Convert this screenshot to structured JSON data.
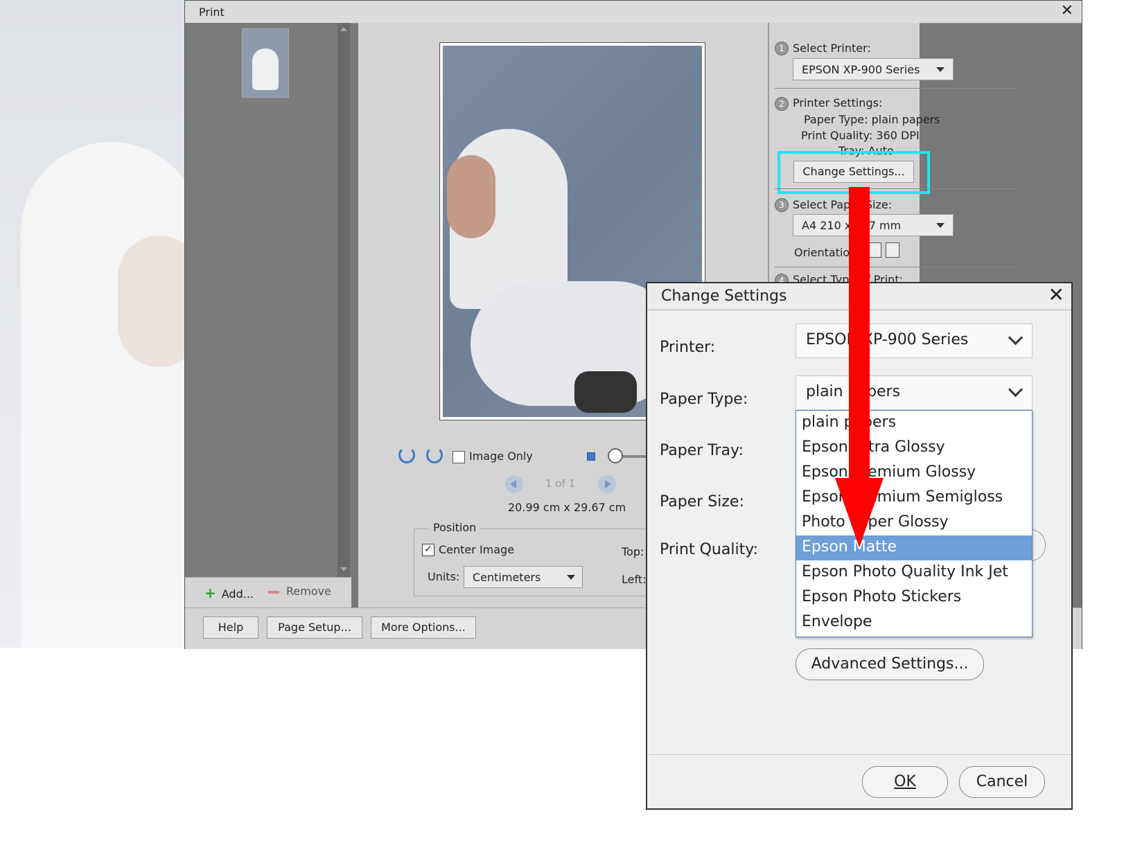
{
  "print_window": {
    "title": "Print",
    "close_glyph": "✕",
    "thumbnails": {
      "add_label": "Add...",
      "remove_label": "Remove"
    },
    "preview": {
      "image_only_label": "Image Only",
      "page_indicator": "1 of 1",
      "dimensions": "20.99 cm x 29.67 cm"
    },
    "position": {
      "legend": "Position",
      "center_image_label": "Center Image",
      "center_image_checked": true,
      "units_label": "Units:",
      "units_value": "Centimeters",
      "top_label": "Top:",
      "left_label": "Left:"
    },
    "bottom_buttons": {
      "help": "Help",
      "page_setup": "Page Setup...",
      "more_options": "More Options..."
    },
    "settings": {
      "step1_num": "1",
      "step1_label": "Select Printer:",
      "printer_value": "EPSON XP-900 Series",
      "step2_num": "2",
      "step2_label": "Printer Settings:",
      "paper_type_line": "Paper Type:  plain papers",
      "print_quality_line": "Print Quality:  360 DPI",
      "tray_line": "Tray:  Auto",
      "change_settings_label": "Change Settings...",
      "step3_num": "3",
      "step3_label": "Select Paper Size:",
      "paper_size_value": "A4 210 x 297 mm",
      "orientation_label": "Orientation:",
      "step4_num": "4",
      "step4_label": "Select Type of Print:"
    }
  },
  "change_settings_dialog": {
    "title": "Change Settings",
    "close_glyph": "✕",
    "printer_label": "Printer:",
    "printer_value": "EPSON XP-900 Series",
    "paper_type_label": "Paper Type:",
    "paper_type_value": "plain papers",
    "paper_tray_label": "Paper Tray:",
    "paper_size_label": "Paper Size:",
    "print_quality_label": "Print Quality:",
    "paper_type_options": [
      "plain papers",
      "Epson Ultra Glossy",
      "Epson Premium Glossy",
      "Epson Premium Semigloss",
      "Photo Paper Glossy",
      "Epson Matte",
      "Epson Photo Quality Ink Jet",
      "Epson Photo Stickers",
      "Envelope"
    ],
    "highlighted_option": "Epson Matte",
    "advanced_settings_label": "Advanced Settings...",
    "ok_label": "OK",
    "cancel_label": "Cancel"
  },
  "annotation": {
    "highlight_color": "#1ee6f0",
    "arrow_color": "#ff0000"
  }
}
